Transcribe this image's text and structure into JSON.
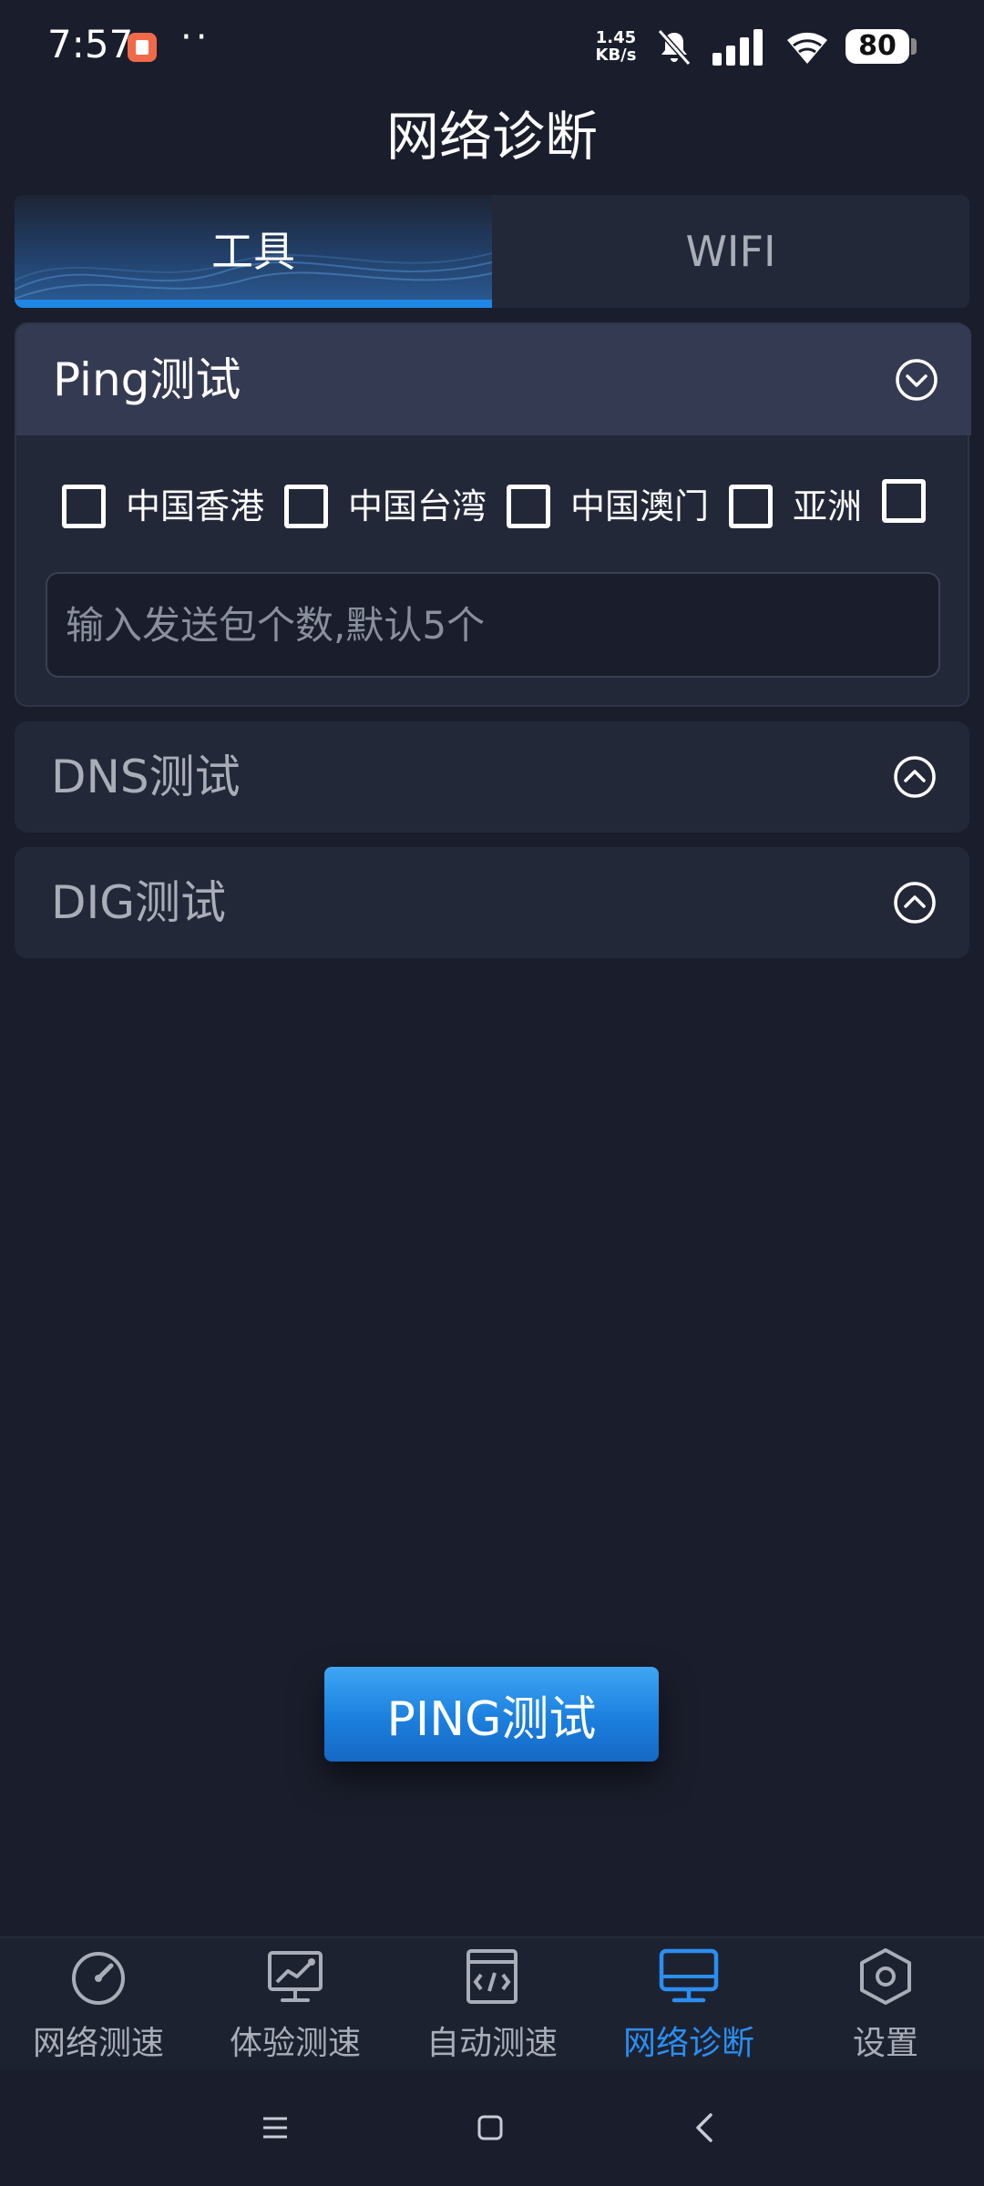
{
  "status_bar": {
    "time": "7:57",
    "dots": "··",
    "net_speed_value": "1.45",
    "net_speed_unit": "KB/s",
    "battery": "80"
  },
  "page_title": "网络诊断",
  "tabs": [
    {
      "label": "工具",
      "active": true
    },
    {
      "label": "WIFI",
      "active": false
    }
  ],
  "ping_section": {
    "title": "Ping测试",
    "regions": [
      {
        "label": "中国香港",
        "checked": false
      },
      {
        "label": "中国台湾",
        "checked": false
      },
      {
        "label": "中国澳门",
        "checked": false
      },
      {
        "label": "亚洲",
        "checked": false
      }
    ],
    "count_placeholder": "输入发送包个数,默认5个"
  },
  "dns_section": {
    "title": "DNS测试"
  },
  "dig_section": {
    "title": "DIG测试"
  },
  "action_button": "PING测试",
  "bottom_nav": [
    {
      "label": "网络测速",
      "icon": "speedometer-icon",
      "active": false
    },
    {
      "label": "体验测速",
      "icon": "chart-monitor-icon",
      "active": false
    },
    {
      "label": "自动测速",
      "icon": "code-window-icon",
      "active": false
    },
    {
      "label": "网络诊断",
      "icon": "monitor-icon",
      "active": true
    },
    {
      "label": "设置",
      "icon": "settings-hex-icon",
      "active": false
    }
  ],
  "colors": {
    "background": "#1a1e2c",
    "panel": "#232839",
    "accent": "#2b8ef0",
    "text_muted": "#a9adb8"
  }
}
